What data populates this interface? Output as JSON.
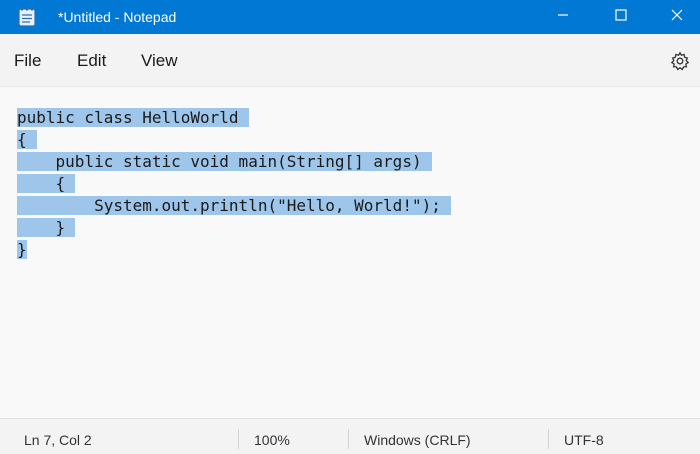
{
  "window": {
    "title": "*Untitled - Notepad",
    "accent_color": "#0078d4",
    "controls": {
      "minimize_icon": "minimize-icon",
      "maximize_icon": "maximize-icon",
      "close_icon": "close-icon"
    }
  },
  "menu": {
    "items": [
      {
        "label": "File"
      },
      {
        "label": "Edit"
      },
      {
        "label": "View"
      }
    ],
    "settings_icon": "gear-icon"
  },
  "editor": {
    "selection_color": "#9ec6ea",
    "lines": [
      "public class HelloWorld",
      "{",
      "    public static void main(String[] args)",
      "    {",
      "        System.out.println(\"Hello, World!\");",
      "    }",
      "}"
    ]
  },
  "status": {
    "position": "Ln 7, Col 2",
    "zoom": "100%",
    "line_ending": "Windows (CRLF)",
    "encoding": "UTF-8"
  }
}
